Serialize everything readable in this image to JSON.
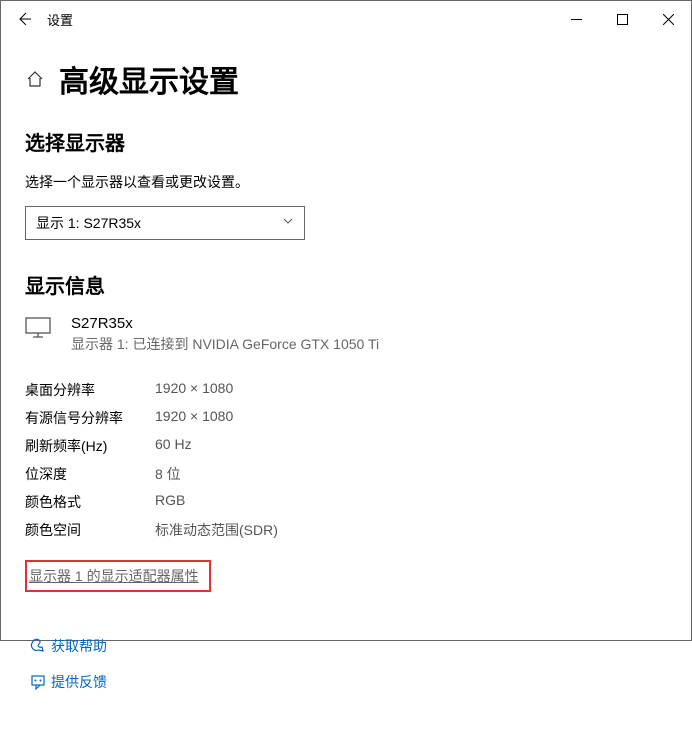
{
  "titlebar": {
    "app_name": "设置"
  },
  "heading": "高级显示设置",
  "select_display": {
    "title": "选择显示器",
    "subtitle": "选择一个显示器以查看或更改设置。",
    "dropdown_value": "显示 1: S27R35x"
  },
  "display_info": {
    "title": "显示信息",
    "monitor_name": "S27R35x",
    "monitor_desc": "显示器 1: 已连接到 NVIDIA GeForce GTX 1050 Ti",
    "rows": [
      {
        "label": "桌面分辨率",
        "value": "1920 × 1080"
      },
      {
        "label": "有源信号分辨率",
        "value": "1920 × 1080"
      },
      {
        "label": "刷新频率(Hz)",
        "value": "60 Hz"
      },
      {
        "label": "位深度",
        "value": "8 位"
      },
      {
        "label": "颜色格式",
        "value": "RGB"
      },
      {
        "label": "颜色空间",
        "value": "标准动态范围(SDR)"
      }
    ],
    "adapter_link": "显示器 1 的显示适配器属性"
  },
  "links": {
    "help": "获取帮助",
    "feedback": "提供反馈"
  }
}
